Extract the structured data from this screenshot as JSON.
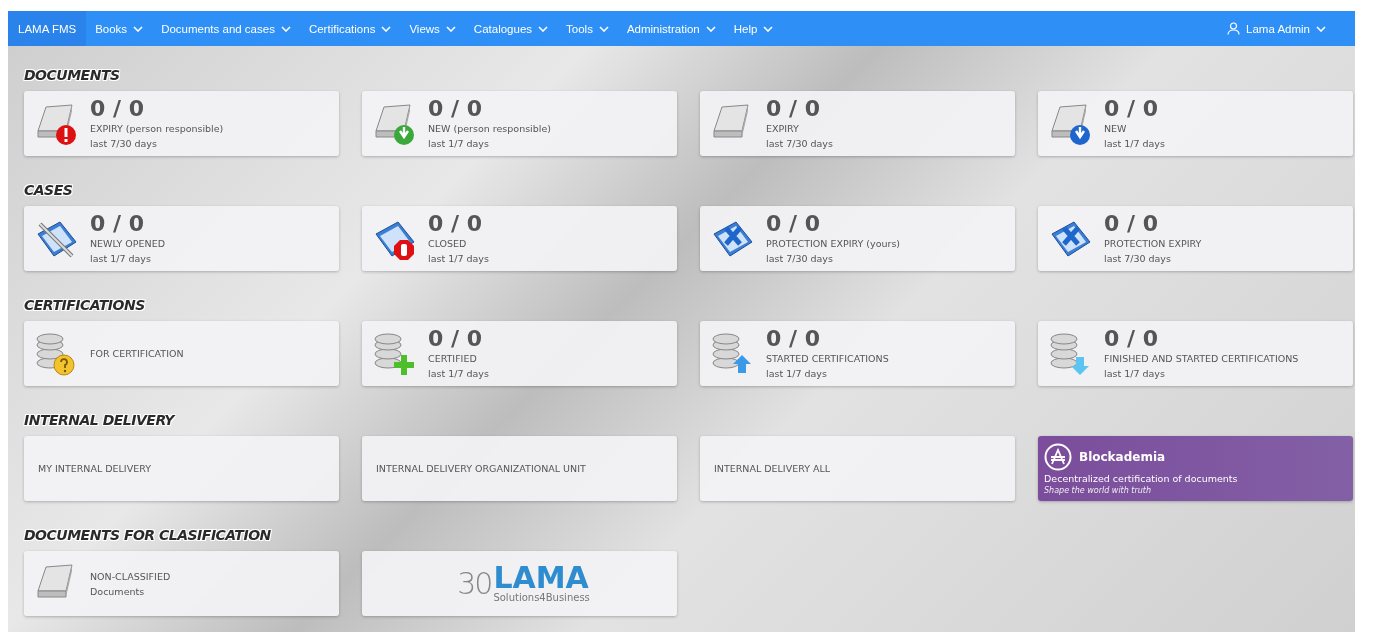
{
  "navbar": {
    "brand": "LAMA FMS",
    "menus": [
      "Books",
      "Documents and cases",
      "Certifications",
      "Views",
      "Catalogues",
      "Tools",
      "Administration",
      "Help"
    ],
    "user": "Lama Admin"
  },
  "sections": [
    {
      "title": "DOCUMENTS",
      "tiles": [
        {
          "kind": "counter",
          "count": "0 / 0",
          "label": "EXPIRY (person responsible)",
          "period": "last 7/30 days"
        },
        {
          "kind": "counter",
          "count": "0 / 0",
          "label": "NEW (person responsible)",
          "period": "last 1/7 days"
        },
        {
          "kind": "counter",
          "count": "0 / 0",
          "label": "EXPIRY",
          "period": "last 7/30 days"
        },
        {
          "kind": "counter",
          "count": "0 / 0",
          "label": "NEW",
          "period": "last 1/7 days"
        }
      ]
    },
    {
      "title": "CASES",
      "tiles": [
        {
          "kind": "counter",
          "count": "0 / 0",
          "label": "NEWLY OPENED",
          "period": "last 1/7 days"
        },
        {
          "kind": "counter",
          "count": "0 / 0",
          "label": "CLOSED",
          "period": "last 1/7 days"
        },
        {
          "kind": "counter",
          "count": "0 / 0",
          "label": "PROTECTION EXPIRY (yours)",
          "period": "last 7/30 days"
        },
        {
          "kind": "counter",
          "count": "0 / 0",
          "label": "PROTECTION EXPIRY",
          "period": "last 7/30 days"
        }
      ]
    },
    {
      "title": "CERTIFICATIONS",
      "tiles": [
        {
          "kind": "counter",
          "label": "FOR CERTIFICATION"
        },
        {
          "kind": "counter",
          "count": "0 / 0",
          "label": "CERTIFIED",
          "period": "last 1/7 days"
        },
        {
          "kind": "counter",
          "count": "0 / 0",
          "label": "STARTED CERTIFICATIONS",
          "period": "last 1/7 days"
        },
        {
          "kind": "counter",
          "count": "0 / 0",
          "label": "FINISHED AND STARTED CERTIFICATIONS",
          "period": "last 1/7 days"
        }
      ]
    },
    {
      "title": "INTERNAL DELIVERY",
      "tiles": [
        {
          "kind": "text",
          "label": "MY INTERNAL DELIVERY"
        },
        {
          "kind": "text",
          "label": "INTERNAL DELIVERY ORGANIZATIONAL UNIT"
        },
        {
          "kind": "text",
          "label": "INTERNAL DELIVERY ALL"
        },
        {
          "kind": "promo",
          "title": "Blockademia",
          "description": "Decentralized certification of documents",
          "tagline": "Shape the world with truth"
        }
      ]
    },
    {
      "title": "DOCUMENTS FOR CLASIFICATION",
      "tiles": [
        {
          "kind": "counter",
          "label": "NON-CLASSIFIED",
          "period": "Documents"
        },
        {
          "kind": "logo",
          "mark": "30",
          "name": "LAMA",
          "subtitle": "Solutions4Business"
        }
      ]
    }
  ]
}
